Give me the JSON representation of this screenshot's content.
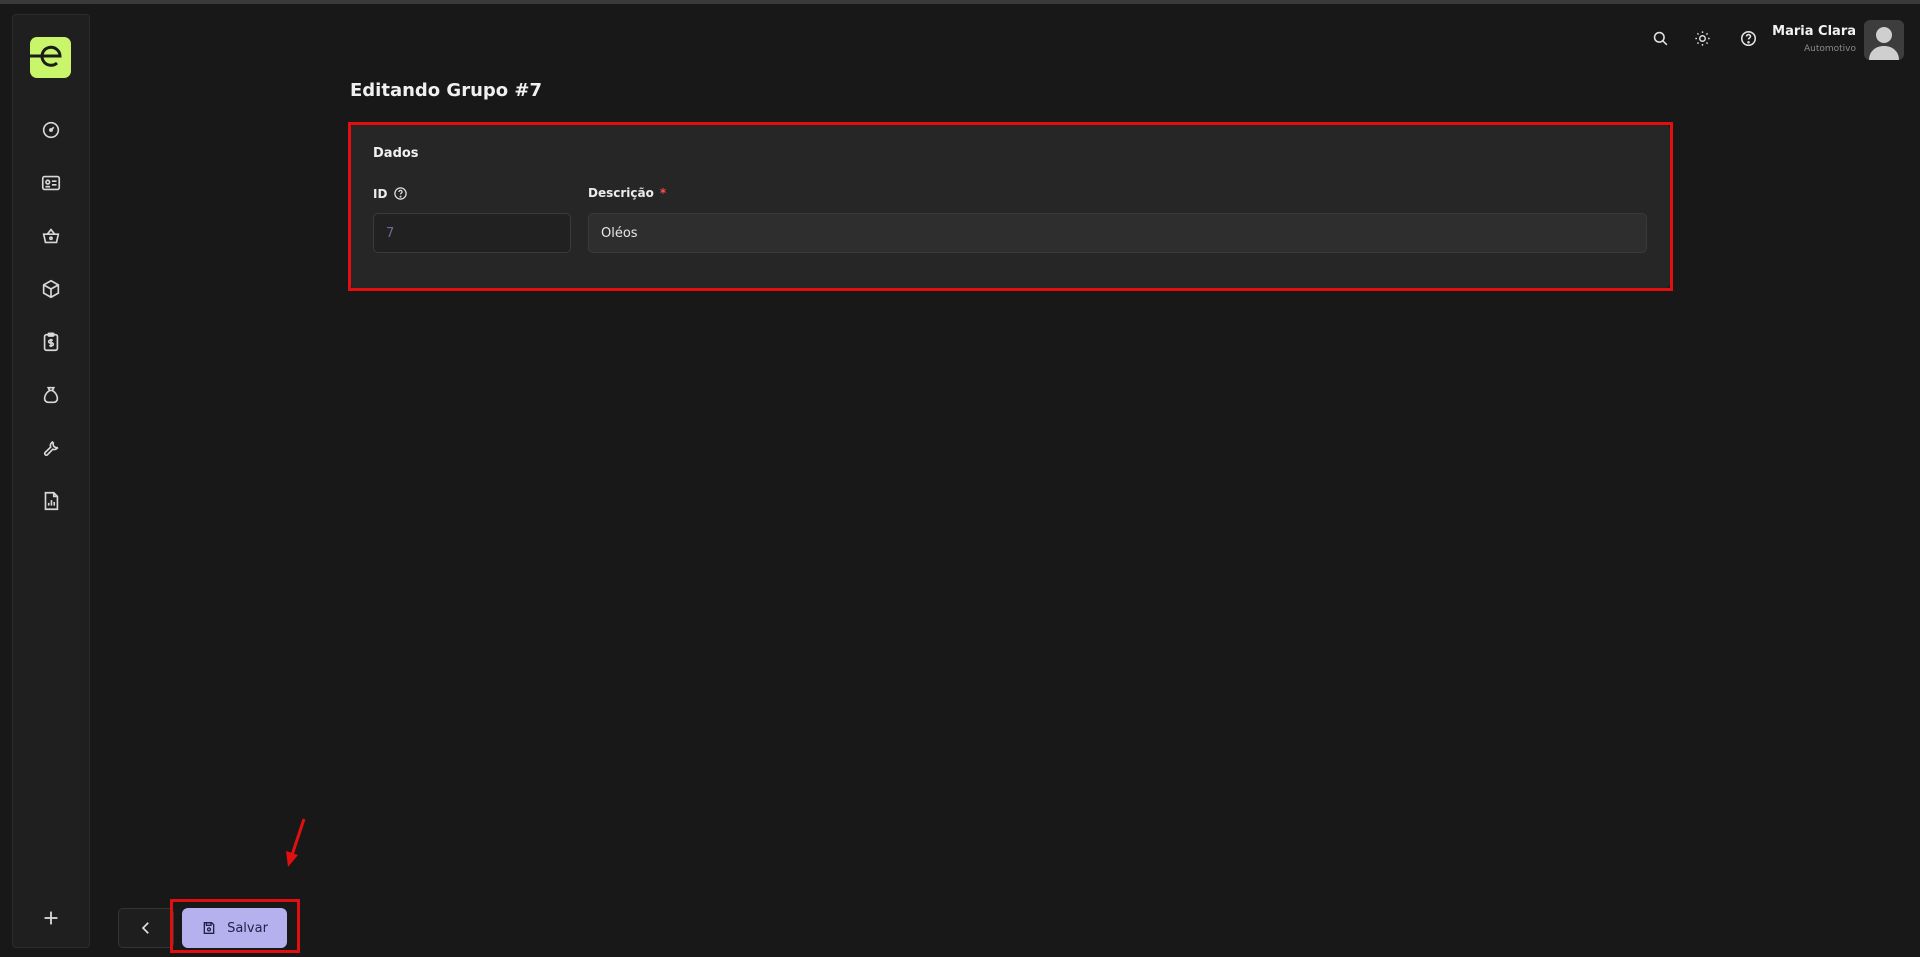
{
  "page": {
    "title": "Editando Grupo #7"
  },
  "sidebar": {
    "logo_letter": "e",
    "items": [
      {
        "icon": "dashboard-gauge-icon"
      },
      {
        "icon": "id-card-icon"
      },
      {
        "icon": "basket-icon"
      },
      {
        "icon": "box-icon"
      },
      {
        "icon": "clipboard-dollar-icon"
      },
      {
        "icon": "money-bag-icon"
      },
      {
        "icon": "wrench-icon"
      },
      {
        "icon": "report-icon"
      }
    ],
    "add_icon": "plus-icon"
  },
  "header": {
    "user_name": "Maria Clara",
    "user_role": "Automotivo"
  },
  "form": {
    "section_title": "Dados",
    "id_label": "ID",
    "id_value": "7",
    "description_label": "Descrição",
    "required_mark": "*",
    "description_value": "Oléos"
  },
  "actions": {
    "save_label": "Salvar"
  },
  "colors": {
    "background": "#181818",
    "card": "#262626",
    "accent_logo": "#c8f56a",
    "save_button": "#b4b1ee",
    "highlight": "#e10f0f"
  }
}
